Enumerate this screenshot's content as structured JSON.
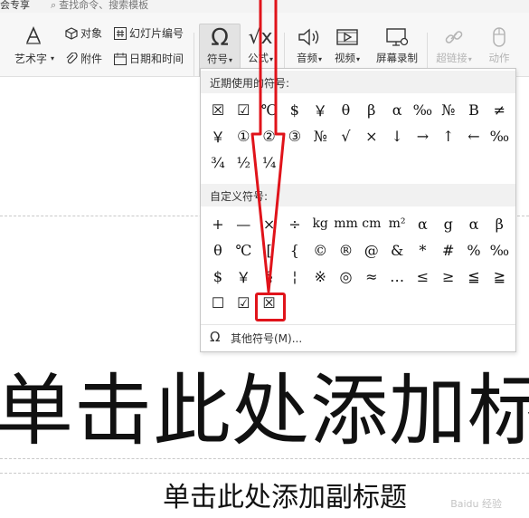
{
  "topbar": {
    "tab_label": "会专享",
    "search_placeholder": "查找命令、搜索模板"
  },
  "ribbon": {
    "art_text_label": "艺术字",
    "object_label": "对象",
    "attachment_label": "附件",
    "slide_number_label": "幻灯片编号",
    "datetime_label": "日期和时间",
    "symbol_label": "符号",
    "formula_label": "公式",
    "audio_label": "音频",
    "video_label": "视频",
    "screen_record_label": "屏幕录制",
    "hyperlink_label": "超链接",
    "animation_label": "动作"
  },
  "symbol_menu": {
    "recent_header": "近期使用的符号:",
    "recent_symbols": [
      [
        "☒",
        "☑",
        "℃",
        "$",
        "￥",
        "θ",
        "β",
        "α",
        "‰",
        "№",
        "B",
        "≠"
      ],
      [
        "￥",
        "①",
        "②",
        "③",
        "№",
        "√",
        "×",
        "↓",
        "→",
        "↑",
        "←",
        "‰"
      ],
      [
        "¾",
        "½",
        "¼"
      ]
    ],
    "custom_header": "自定义符号:",
    "custom_symbols": [
      [
        "+",
        "—",
        "×",
        "÷",
        "kg",
        "mm",
        "cm",
        "m²",
        "α",
        "g",
        "α",
        "β"
      ],
      [
        "θ",
        "℃",
        "[",
        "{",
        "©",
        "®",
        "@",
        "&",
        "*",
        "#",
        "%",
        "‰"
      ],
      [
        "$",
        "￥",
        "§",
        "¦",
        "※",
        "◎",
        "≈",
        "…",
        "≤",
        "≥",
        "≦",
        "≧"
      ],
      [
        "☐",
        "☑",
        "☒"
      ]
    ],
    "more_label": "其他符号(M)..."
  },
  "slide": {
    "title_placeholder": "单击此处添加标",
    "subtitle_placeholder": "单击此处添加副标题"
  },
  "watermark": "Baidu 经验",
  "colors": {
    "highlight_red": "#e0131a",
    "header_bg": "#f1f1f1",
    "ribbon_bg": "#f7f7f7"
  }
}
